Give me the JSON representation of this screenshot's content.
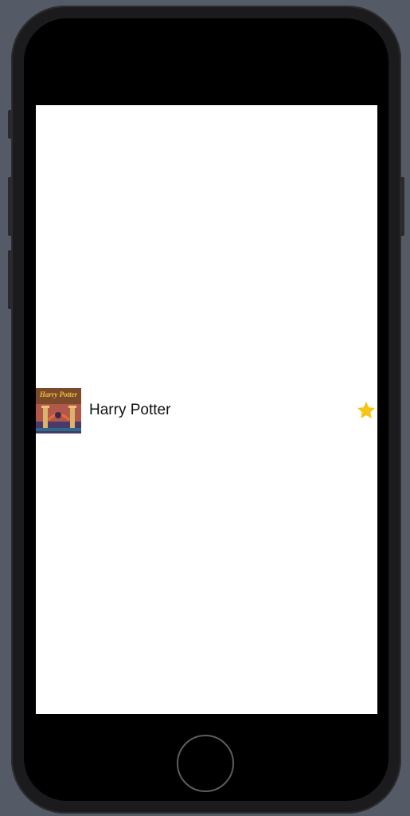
{
  "book_list": {
    "items": [
      {
        "title": "Harry Potter",
        "cover_icon": "book-cover-image",
        "favorite_icon": "star-icon",
        "favorite": true
      }
    ]
  },
  "colors": {
    "star": "#F5C518",
    "screen_background": "#FFFFFF",
    "device_frame": "#1B1B1D",
    "desktop_background": "#555B66"
  }
}
